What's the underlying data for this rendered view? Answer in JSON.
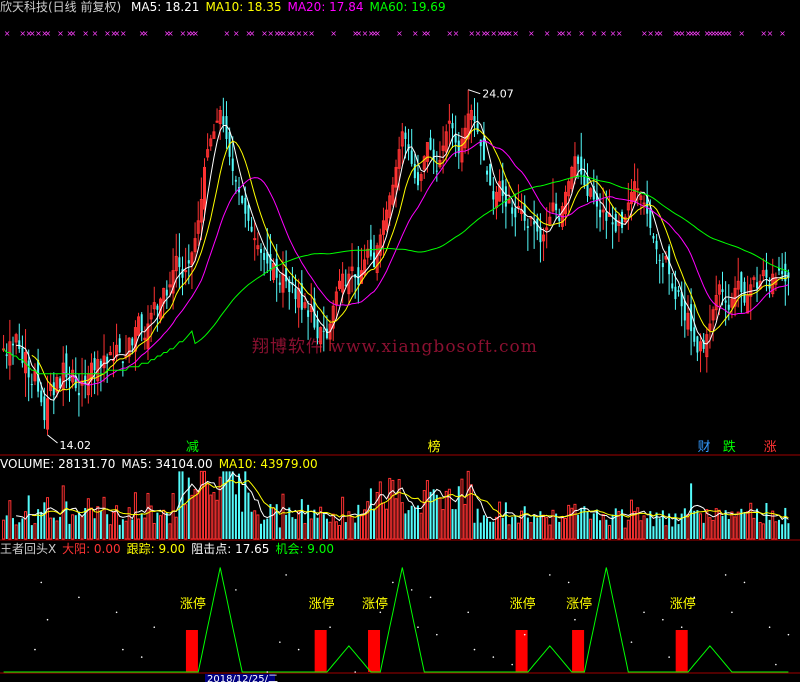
{
  "chart_data": [
    {
      "type": "candlestick",
      "panel": "price",
      "title": "欣天科技(日线 前复权)",
      "indicators": [
        {
          "name": "MA5",
          "value": 18.21,
          "color": "#ffffff"
        },
        {
          "name": "MA10",
          "value": 18.35,
          "color": "#ffff00"
        },
        {
          "name": "MA20",
          "value": 17.84,
          "color": "#ff00ff"
        },
        {
          "name": "MA60",
          "value": 19.69,
          "color": "#00ff00"
        }
      ],
      "ylim": [
        13.5,
        25.5
      ],
      "annotations": {
        "high": "24.07",
        "low": "14.02"
      },
      "event_labels": [
        {
          "text": "减",
          "bar": 60,
          "color": "#00ff00"
        },
        {
          "text": "榜",
          "bar": 137,
          "color": "#ffff00"
        },
        {
          "text": "财",
          "bar": 223,
          "color": "#3399ff"
        },
        {
          "text": "跌",
          "bar": 231,
          "color": "#00ff00"
        },
        {
          "text": "涨",
          "bar": 244,
          "color": "#ff3333"
        }
      ],
      "close": [
        16.2,
        16.0,
        16.4,
        16.3,
        16.6,
        16.2,
        15.8,
        16.1,
        15.4,
        15.2,
        15.6,
        15.0,
        14.7,
        14.2,
        14.8,
        15.2,
        14.9,
        15.4,
        15.1,
        15.8,
        15.4,
        15.3,
        15.6,
        15.1,
        14.9,
        15.3,
        15.2,
        15.5,
        15.8,
        15.6,
        15.9,
        15.7,
        16.0,
        15.8,
        16.1,
        15.9,
        16.3,
        16.1,
        15.8,
        16.0,
        16.5,
        16.3,
        16.8,
        17.1,
        16.7,
        16.5,
        16.9,
        17.2,
        17.5,
        17.3,
        17.6,
        17.9,
        17.7,
        18.0,
        18.4,
        18.8,
        18.5,
        18.2,
        18.4,
        18.6,
        18.9,
        19.3,
        19.8,
        20.4,
        21.3,
        21.8,
        22.1,
        22.3,
        22.6,
        22.9,
        22.5,
        22.1,
        21.6,
        21.2,
        20.9,
        20.6,
        20.3,
        20.0,
        19.8,
        19.5,
        19.3,
        19.1,
        18.9,
        18.7,
        18.6,
        18.4,
        18.6,
        18.2,
        18.0,
        18.3,
        18.1,
        17.8,
        18.0,
        17.6,
        17.9,
        17.3,
        17.5,
        17.1,
        17.4,
        16.8,
        16.5,
        16.8,
        16.7,
        16.5,
        16.9,
        17.4,
        17.8,
        18.1,
        18.3,
        18.0,
        18.3,
        18.5,
        18.2,
        18.0,
        18.4,
        18.7,
        19.0,
        18.8,
        18.5,
        19.1,
        19.4,
        19.8,
        20.1,
        20.5,
        20.8,
        21.3,
        21.8,
        22.3,
        22.1,
        21.8,
        21.4,
        21.0,
        20.8,
        21.1,
        21.6,
        22.0,
        21.8,
        21.5,
        21.2,
        21.5,
        21.9,
        22.3,
        22.6,
        22.4,
        22.0,
        21.7,
        22.1,
        22.4,
        22.8,
        22.9,
        22.6,
        22.3,
        21.9,
        21.5,
        21.1,
        20.8,
        20.4,
        20.6,
        20.9,
        20.5,
        20.2,
        20.4,
        20.0,
        19.9,
        20.2,
        20.1,
        19.8,
        19.6,
        19.9,
        19.7,
        19.5,
        19.2,
        19.4,
        19.6,
        19.9,
        20.3,
        20.1,
        19.8,
        20.2,
        20.6,
        20.9,
        21.3,
        21.6,
        21.4,
        21.1,
        20.8,
        20.5,
        20.7,
        20.4,
        20.2,
        19.9,
        20.1,
        19.8,
        20.0,
        19.7,
        19.5,
        19.8,
        19.6,
        19.9,
        20.3,
        20.6,
        20.9,
        20.7,
        20.5,
        20.3,
        20.0,
        19.6,
        19.3,
        19.0,
        18.7,
        18.5,
        18.8,
        18.3,
        17.9,
        17.6,
        17.8,
        17.4,
        17.0,
        17.2,
        16.7,
        16.4,
        16.1,
        16.4,
        16.2,
        16.6,
        16.9,
        17.3,
        17.7,
        18.0,
        17.8,
        17.5,
        17.3,
        17.6,
        17.9,
        18.1,
        17.8,
        17.5,
        17.7,
        18.0,
        18.2,
        17.9,
        18.1,
        18.4,
        18.2,
        17.9,
        18.3,
        18.2,
        18.4,
        18.3,
        18.1,
        18.2
      ],
      "ma60": [
        16.2,
        16.1,
        16.1,
        16.0,
        16.0,
        15.9,
        15.9,
        15.8,
        15.7,
        15.6,
        15.6,
        15.5,
        15.5,
        15.5,
        15.5,
        15.5,
        15.5,
        15.5,
        15.5,
        15.5,
        15.5,
        15.5,
        15.5,
        15.5,
        15.5,
        15.5,
        15.5,
        15.5,
        15.5,
        15.5,
        15.5,
        15.5,
        15.5,
        15.6,
        15.6,
        15.6,
        15.6,
        15.6,
        15.6,
        15.6,
        15.7,
        15.7,
        15.7,
        15.7,
        15.8,
        15.8,
        15.8,
        15.9,
        15.9,
        16.0,
        16.0,
        16.1,
        16.1,
        16.2,
        16.2,
        16.3,
        16.4,
        16.4,
        16.5,
        16.6,
        16.7
      ]
    },
    {
      "type": "bar",
      "panel": "volume",
      "indicators": [
        {
          "name": "VOLUME",
          "value": 28131.7,
          "color": "#ffffff"
        },
        {
          "name": "MA5",
          "value": 34104.0,
          "color": "#ffffff"
        },
        {
          "name": "MA10",
          "value": 43979.0,
          "color": "#ffff00"
        }
      ],
      "ylim": [
        0,
        75000
      ]
    },
    {
      "type": "line",
      "panel": "indicator",
      "title": "王者回头X",
      "indicators": [
        {
          "name": "大阳",
          "value": 0.0,
          "color": "#ff3333"
        },
        {
          "name": "跟踪",
          "value": 9.0,
          "color": "#ffff00"
        },
        {
          "name": "阻击点",
          "value": 17.65,
          "color": "#ffffff"
        },
        {
          "name": "机会",
          "value": 9.0,
          "color": "#00ff00"
        }
      ],
      "signal_label": "涨停",
      "signals": [
        60,
        101,
        118,
        165,
        183,
        216
      ],
      "ylim": [
        0,
        30
      ]
    }
  ],
  "footer": {
    "date_label": "2018/12/25/二"
  }
}
